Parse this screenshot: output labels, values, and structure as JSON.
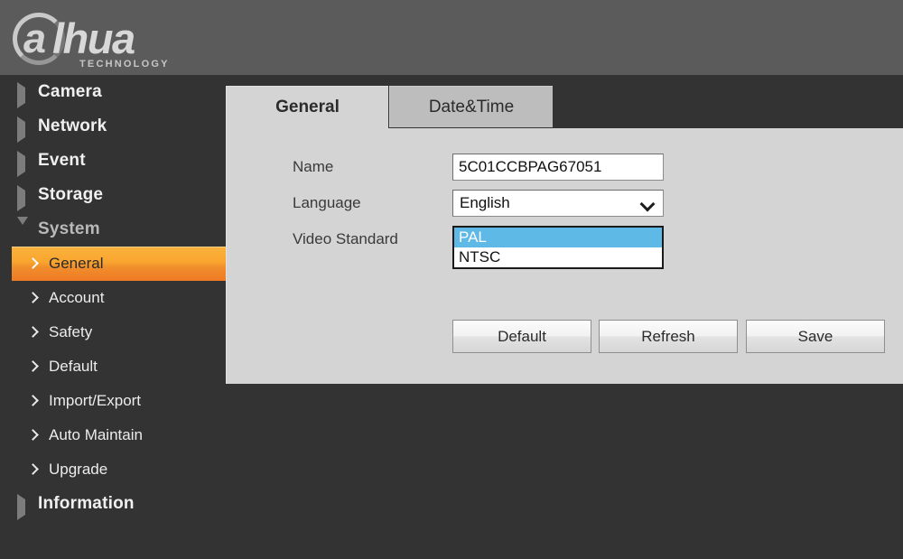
{
  "header": {
    "logo_mark": "dahua-circle-a-logo",
    "brand_a": "a",
    "brand_word": "lhua",
    "brand_sub": "TECHNOLOGY"
  },
  "sidebar": {
    "top_items": [
      {
        "label": "Camera",
        "icon": "triangle-right-icon",
        "expanded": false
      },
      {
        "label": "Network",
        "icon": "triangle-right-icon",
        "expanded": false
      },
      {
        "label": "Event",
        "icon": "triangle-right-icon",
        "expanded": false
      },
      {
        "label": "Storage",
        "icon": "triangle-right-icon",
        "expanded": false
      },
      {
        "label": "System",
        "icon": "triangle-down-icon",
        "expanded": true
      },
      {
        "label": "Information",
        "icon": "triangle-right-icon",
        "expanded": false
      }
    ],
    "sub_items": [
      {
        "label": "General",
        "icon": "chevron-right-icon",
        "active": true
      },
      {
        "label": "Account",
        "icon": "chevron-right-icon",
        "active": false
      },
      {
        "label": "Safety",
        "icon": "chevron-right-icon",
        "active": false
      },
      {
        "label": "Default",
        "icon": "chevron-right-icon",
        "active": false
      },
      {
        "label": "Import/Export",
        "icon": "chevron-right-icon",
        "active": false
      },
      {
        "label": "Auto Maintain",
        "icon": "chevron-right-icon",
        "active": false
      },
      {
        "label": "Upgrade",
        "icon": "chevron-right-icon",
        "active": false
      }
    ],
    "highlight_color": "#f7a236"
  },
  "tabs": [
    {
      "label": "General",
      "active": true
    },
    {
      "label": "Date&Time",
      "active": false
    }
  ],
  "form": {
    "name": {
      "label": "Name",
      "value": "5C01CCBPAG67051",
      "placeholder": ""
    },
    "language": {
      "label": "Language",
      "value": "English",
      "arrow_icon": "chevron-down-icon"
    },
    "video_standard": {
      "label": "Video Standard",
      "options": [
        {
          "label": "PAL",
          "selected": true
        },
        {
          "label": "NTSC",
          "selected": false
        }
      ],
      "selected_value": "PAL",
      "selection_color": "#5fb9e6"
    }
  },
  "buttons": {
    "default_label": "Default",
    "refresh_label": "Refresh",
    "save_label": "Save"
  }
}
